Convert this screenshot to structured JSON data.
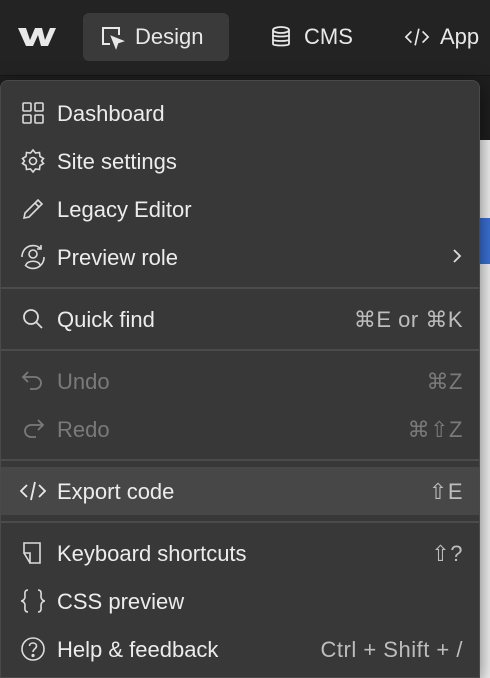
{
  "topbar": {
    "tabs": [
      {
        "label": "Design",
        "icon": "design-cursor-icon",
        "active": true
      },
      {
        "label": "CMS",
        "icon": "database-icon",
        "active": false
      },
      {
        "label": "App",
        "icon": "code-icon",
        "active": false
      }
    ]
  },
  "menu": {
    "items": [
      {
        "label": "Dashboard",
        "icon": "grid-icon",
        "shortcut": ""
      },
      {
        "label": "Site settings",
        "icon": "gear-icon",
        "shortcut": ""
      },
      {
        "label": "Legacy Editor",
        "icon": "pencil-icon",
        "shortcut": ""
      },
      {
        "label": "Preview role",
        "icon": "preview-role-icon",
        "shortcut": "",
        "submenu": ">"
      },
      {
        "label": "Quick find",
        "icon": "search-icon",
        "shortcut": "⌘E or ⌘K"
      },
      {
        "label": "Undo",
        "icon": "undo-icon",
        "shortcut": "⌘Z",
        "disabled": true
      },
      {
        "label": "Redo",
        "icon": "redo-icon",
        "shortcut": "⌘⇧Z",
        "disabled": true
      },
      {
        "label": "Export code",
        "icon": "code-icon",
        "shortcut": "⇧E",
        "highlighted": true
      },
      {
        "label": "Keyboard shortcuts",
        "icon": "keyboard-shortcut-icon",
        "shortcut": "⇧?"
      },
      {
        "label": "CSS preview",
        "icon": "braces-icon",
        "shortcut": ""
      },
      {
        "label": "Help & feedback",
        "icon": "help-icon",
        "shortcut": "Ctrl + Shift + /"
      }
    ]
  },
  "colors": {
    "menu_bg": "#383838",
    "highlight_bg": "#474747",
    "accent_blue": "#3b72d9"
  }
}
